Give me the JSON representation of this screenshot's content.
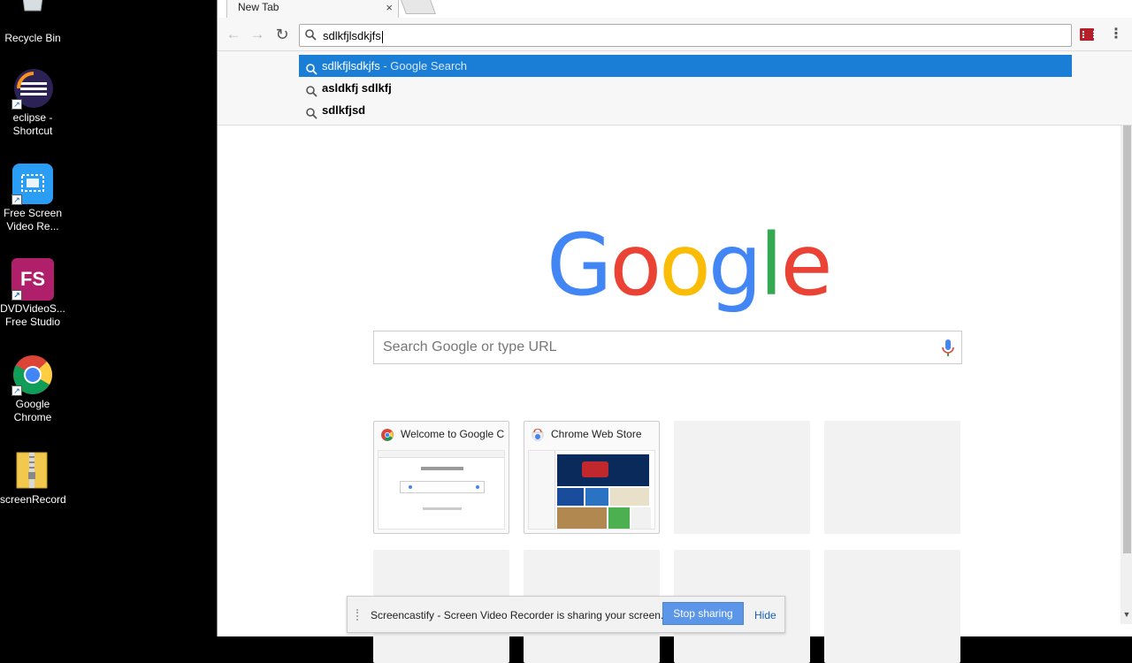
{
  "desktop": {
    "icons": [
      {
        "label": "Recycle Bin",
        "icon": "recycle-bin-icon"
      },
      {
        "label": "eclipse - Shortcut",
        "icon": "eclipse-icon"
      },
      {
        "label": "Free Screen Video Re...",
        "icon": "screen-recorder-icon"
      },
      {
        "label": "DVDVideoS... Free Studio",
        "icon": "fs-icon",
        "icon_text": "FS"
      },
      {
        "label": "Google Chrome",
        "icon": "chrome-icon"
      },
      {
        "label": "screenRecord",
        "icon": "zip-folder-icon"
      }
    ]
  },
  "browser": {
    "tab": {
      "title": "New Tab",
      "close": "×"
    },
    "omnibox": {
      "value": "sdlkfjlsdkjfs"
    },
    "suggestions": [
      {
        "bold": "sdlkfjlsdkjfs",
        "suffix": " - Google Search",
        "selected": true
      },
      {
        "bold": "asldkfj sdlkfj",
        "suffix": "",
        "selected": false
      },
      {
        "bold": "sdlkfjsd",
        "suffix": "",
        "selected": false
      }
    ],
    "colors": {
      "accent": "#1a7ed6",
      "google_blue": "#4285f4",
      "google_red": "#ea4335",
      "google_yellow": "#fbbc05",
      "google_green": "#34a853"
    }
  },
  "ntp": {
    "logo_letters": [
      "G",
      "o",
      "o",
      "g",
      "l",
      "e"
    ],
    "search_placeholder": "Search Google or type URL",
    "tiles": [
      {
        "title": "Welcome to Google C"
      },
      {
        "title": "Chrome Web Store"
      }
    ]
  },
  "notification": {
    "message": "Screencastify - Screen Video Recorder is sharing your screen.",
    "stop_label": "Stop sharing",
    "hide_label": "Hide"
  }
}
